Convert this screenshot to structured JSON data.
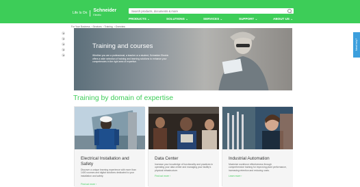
{
  "header": {
    "tagline": "Life Is On",
    "brand": "Schneider",
    "brand_sub": "Electric",
    "search_placeholder": "Search products, documents & more",
    "nav": [
      "PRODUCTS ⌄",
      "SOLUTIONS ⌄",
      "SERVICES ⌄",
      "SUPPORT ⌄",
      "ABOUT US ⌄"
    ]
  },
  "breadcrumb": [
    "For Your Business",
    "Services",
    "Training",
    "Overview"
  ],
  "hero": {
    "title": "Training and courses",
    "description": "Whether you are a professional, a teacher or a student, Schneider Electric offers a wide selection of training and learning solutions to enhance your competencies in the right area of expertise."
  },
  "side_tab": "Need help?",
  "section_title": "Training by domain of expertise",
  "cards": [
    {
      "title": "Electrical Installation and Safety",
      "description": "Discover a unique learning experience with more than 1400 courses and digital solutions dedicated to your installation and safety.",
      "link": "Find out more ›"
    },
    {
      "title": "Data Center",
      "description": "Increase your knowledge of functionality and practices in operating your data center and managing your facility's physical infrastructure.",
      "link": "Find out more ›"
    },
    {
      "title": "Industrial Automation",
      "description": "Maximize workforce effectiveness through comprehensive training for improving plant performance, increasing retention and reducing costs.",
      "link": "Learn more ›"
    }
  ],
  "colors": {
    "brand_green": "#3dcd58",
    "side_tab_blue": "#3c9fdd"
  },
  "icons": [
    "share-icon",
    "search-icon"
  ]
}
